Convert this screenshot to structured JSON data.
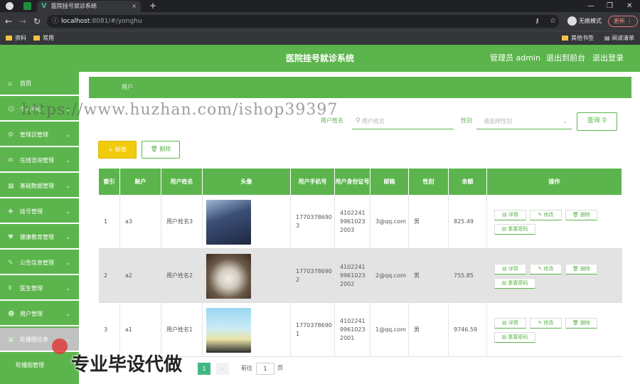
{
  "browser": {
    "tab_title": "医院挂号就诊系统",
    "url_host": "localhost",
    "url_path": ":8081/#/yonghu",
    "incognito_label": "无痕模式",
    "update_label": "更新",
    "bookmarks": [
      "资料",
      "常用"
    ],
    "bookmarks_right": [
      "其他书签",
      "阅读清单"
    ]
  },
  "header": {
    "title": "医院挂号就诊系统",
    "admin_label": "管理员 admin",
    "back_frontend": "退出到前台",
    "logout": "退出登录"
  },
  "sidebar": {
    "items": [
      {
        "label": "首页",
        "expandable": false
      },
      {
        "label": "个人中心",
        "expandable": true
      },
      {
        "label": "管理员管理",
        "expandable": true
      },
      {
        "label": "在线咨询管理",
        "expandable": true
      },
      {
        "label": "基础数据管理",
        "expandable": true
      },
      {
        "label": "挂号管理",
        "expandable": true
      },
      {
        "label": "健康教育管理",
        "expandable": true
      },
      {
        "label": "公告信息管理",
        "expandable": true
      },
      {
        "label": "医生管理",
        "expandable": true
      },
      {
        "label": "用户管理",
        "expandable": true
      },
      {
        "label": "轮播图信息",
        "expandable": true
      }
    ],
    "subitem": "轮播图管理"
  },
  "breadcrumb": "用户",
  "search": {
    "name_label": "用户姓名",
    "name_placeholder": "用户姓名",
    "sex_label": "性别",
    "sex_placeholder": "请选择性别",
    "query_label": "查询"
  },
  "actions": {
    "add_label": "+ 新增",
    "delete_label": "删除"
  },
  "table": {
    "headers": [
      "索引",
      "账户",
      "用户姓名",
      "头像",
      "用户手机号",
      "用户身份证号",
      "邮箱",
      "性别",
      "余额",
      "操作"
    ],
    "rows": [
      {
        "index": "1",
        "account": "a3",
        "name": "用户姓名3",
        "avatar": "avatar-boy",
        "phone": "17703786903",
        "id_card": "410224199610232003",
        "email": "3@qq.com",
        "sex": "男",
        "balance": "825.49"
      },
      {
        "index": "2",
        "account": "a2",
        "name": "用户姓名2",
        "avatar": "avatar-cat",
        "phone": "17703786902",
        "id_card": "410224199610232002",
        "email": "2@qq.com",
        "sex": "男",
        "balance": "755.85"
      },
      {
        "index": "3",
        "account": "a1",
        "name": "用户姓名1",
        "avatar": "avatar-girl",
        "phone": "17703786901",
        "id_card": "410224199610232001",
        "email": "1@qq.com",
        "sex": "男",
        "balance": "9746.59"
      }
    ],
    "ops": [
      "详情",
      "修改",
      "删除",
      "重置密码"
    ]
  },
  "pagination": {
    "current": "1",
    "goto_label": "前往",
    "page_value": "1",
    "page_unit": "页"
  },
  "overlay": {
    "watermark": "https://www.huzhan.com/ishop39397",
    "promo": "专业毕设代做"
  },
  "colors": {
    "primary": "#5cb54c",
    "warning": "#f2cc0c",
    "sidebar_active": "#bfc2bf"
  }
}
